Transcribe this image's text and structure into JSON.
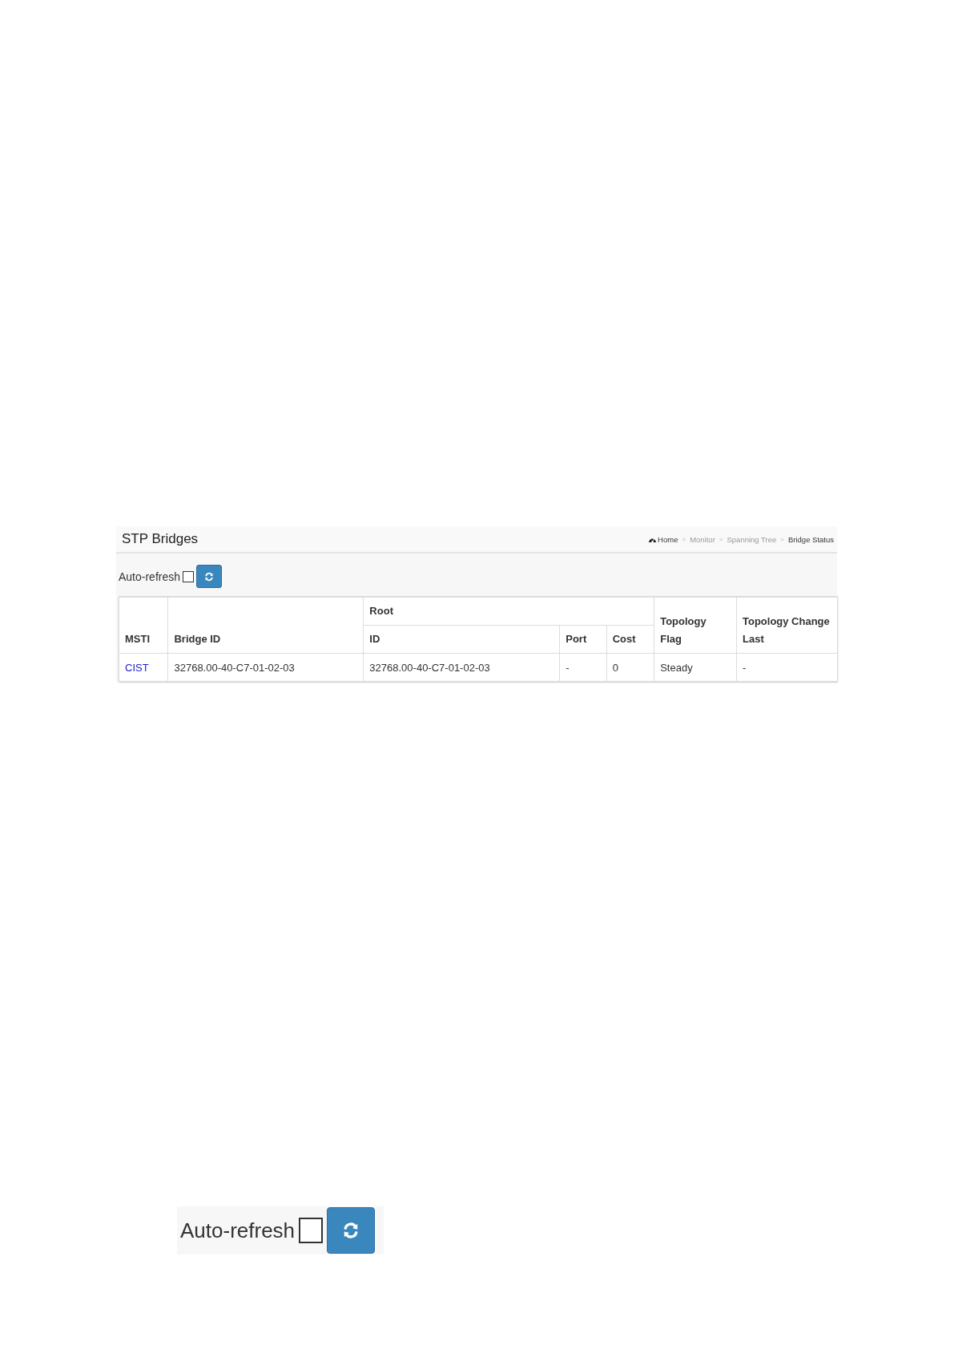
{
  "panel": {
    "title": "STP Bridges",
    "breadcrumb": {
      "separator": ">",
      "items": [
        {
          "label": "Home",
          "kind": "home"
        },
        {
          "label": "Monitor",
          "kind": "link"
        },
        {
          "label": "Spanning Tree",
          "kind": "link"
        },
        {
          "label": "Bridge Status",
          "kind": "current"
        }
      ]
    },
    "auto_refresh": {
      "label": "Auto-refresh",
      "checked": false
    },
    "table": {
      "header_rows": [
        [
          {
            "label": "MSTI",
            "rowspan": 2
          },
          {
            "label": "Bridge ID",
            "rowspan": 2
          },
          {
            "label": "Root",
            "colspan": 3
          },
          {
            "label": "Topology Flag",
            "rowspan": 2
          },
          {
            "label": "Topology Change Last",
            "rowspan": 2
          }
        ],
        [
          {
            "label": "ID"
          },
          {
            "label": "Port"
          },
          {
            "label": "Cost"
          }
        ]
      ],
      "rows": [
        {
          "cells": [
            {
              "text": "CIST",
              "kind": "link"
            },
            {
              "text": "32768.00-40-C7-01-02-03",
              "kind": "text"
            },
            {
              "text": "32768.00-40-C7-01-02-03",
              "kind": "text"
            },
            {
              "text": "-",
              "kind": "text"
            },
            {
              "text": "0",
              "kind": "text"
            },
            {
              "text": "Steady",
              "kind": "text"
            },
            {
              "text": "-",
              "kind": "text"
            }
          ]
        }
      ]
    }
  },
  "enlarged_auto_refresh": {
    "label": "Auto-refresh",
    "checked": false
  }
}
